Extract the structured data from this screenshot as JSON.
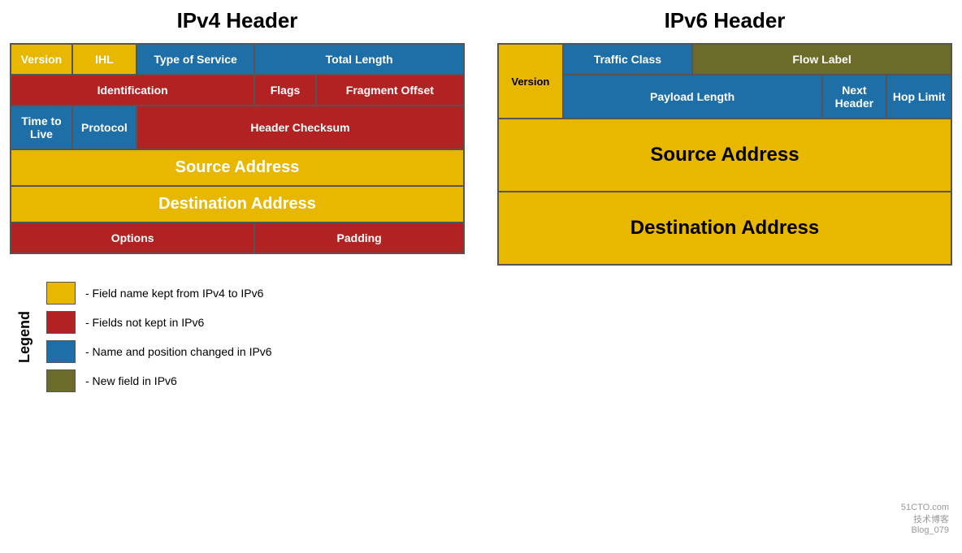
{
  "ipv4": {
    "title": "IPv4 Header",
    "rows": [
      [
        {
          "label": "Version",
          "color": "yellow",
          "colspan": 1,
          "rowspan": 1
        },
        {
          "label": "IHL",
          "color": "yellow",
          "colspan": 1,
          "rowspan": 1
        },
        {
          "label": "Type of Service",
          "color": "blue",
          "colspan": 1,
          "rowspan": 1
        },
        {
          "label": "Total Length",
          "color": "blue",
          "colspan": 2,
          "rowspan": 1
        }
      ],
      [
        {
          "label": "Identification",
          "color": "red",
          "colspan": 3,
          "rowspan": 1
        },
        {
          "label": "Flags",
          "color": "red",
          "colspan": 1,
          "rowspan": 1
        },
        {
          "label": "Fragment Offset",
          "color": "red",
          "colspan": 1,
          "rowspan": 1
        }
      ],
      [
        {
          "label": "Time to Live",
          "color": "blue",
          "colspan": 1,
          "rowspan": 1
        },
        {
          "label": "Protocol",
          "color": "blue",
          "colspan": 1,
          "rowspan": 1
        },
        {
          "label": "Header Checksum",
          "color": "red",
          "colspan": 3,
          "rowspan": 1
        }
      ],
      [
        {
          "label": "Source Address",
          "color": "yellow",
          "colspan": 5,
          "rowspan": 1
        }
      ],
      [
        {
          "label": "Destination Address",
          "color": "yellow",
          "colspan": 5,
          "rowspan": 1
        }
      ],
      [
        {
          "label": "Options",
          "color": "red",
          "colspan": 3,
          "rowspan": 1
        },
        {
          "label": "Padding",
          "color": "red",
          "colspan": 2,
          "rowspan": 1
        }
      ]
    ]
  },
  "ipv6": {
    "title": "IPv6 Header",
    "rows": [
      [
        {
          "label": "Version",
          "color": "yellow",
          "colspan": 1,
          "rowspan": 2
        },
        {
          "label": "Traffic Class",
          "color": "blue",
          "colspan": 2,
          "rowspan": 1
        },
        {
          "label": "Flow Label",
          "color": "olive",
          "colspan": 4,
          "rowspan": 1
        }
      ],
      [
        {
          "label": "Payload Length",
          "color": "blue",
          "colspan": 4,
          "rowspan": 1
        },
        {
          "label": "Next Header",
          "color": "blue",
          "colspan": 1,
          "rowspan": 1
        },
        {
          "label": "Hop Limit",
          "color": "blue",
          "colspan": 1,
          "rowspan": 1
        }
      ],
      [
        {
          "label": "Source Address",
          "color": "yellow",
          "colspan": 7,
          "rowspan": 1,
          "tall": true
        }
      ],
      [
        {
          "label": "Destination Address",
          "color": "yellow",
          "colspan": 7,
          "rowspan": 1,
          "tall": true
        }
      ]
    ]
  },
  "legend": {
    "title": "Legend",
    "items": [
      {
        "color": "#E8B800",
        "text": "- Field name kept from IPv4 to IPv6"
      },
      {
        "color": "#B22222",
        "text": "- Fields not kept in IPv6"
      },
      {
        "color": "#1E6FA8",
        "text": "- Name and position changed in IPv6"
      },
      {
        "color": "#6B6B2A",
        "text": "- New field in IPv6"
      }
    ]
  },
  "watermark": {
    "line1": "51CTO.com",
    "line2": "技术博客",
    "line3": "Blog_079"
  }
}
